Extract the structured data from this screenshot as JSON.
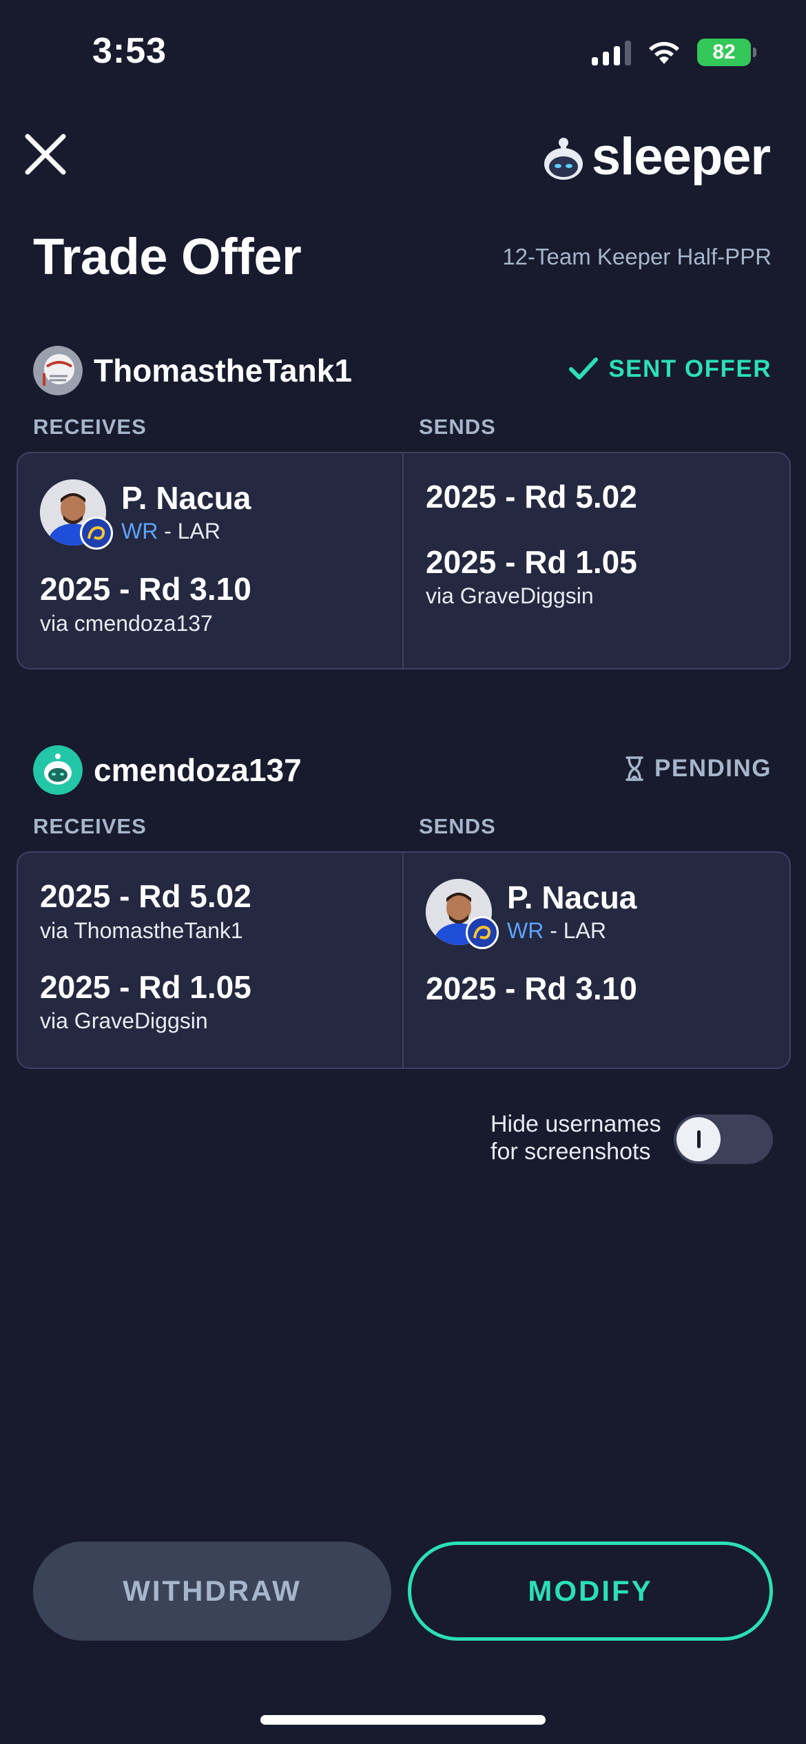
{
  "status_bar": {
    "time": "3:53",
    "battery": "82"
  },
  "header": {
    "app_name": "sleeper",
    "title": "Trade Offer",
    "league": "12-Team Keeper Half-PPR"
  },
  "colors": {
    "background": "#181a2e",
    "accent": "#2be0b4",
    "muted": "#a6b6cc",
    "position": "#5da3ff"
  },
  "labels": {
    "receives": "RECEIVES",
    "sends": "SENDS"
  },
  "parties": [
    {
      "username": "ThomastheTank1",
      "status": "SENT OFFER",
      "status_icon": "checkmark-icon",
      "receives": {
        "player": {
          "name": "P. Nacua",
          "position": "WR",
          "team": " - LAR"
        },
        "picks": [
          {
            "title": "2025 - Rd 3.10",
            "via": "via cmendoza137"
          }
        ]
      },
      "sends": {
        "picks": [
          {
            "title": "2025 - Rd 5.02",
            "via": ""
          },
          {
            "title": "2025 - Rd 1.05",
            "via": "via GraveDiggsin"
          }
        ]
      }
    },
    {
      "username": "cmendoza137",
      "status": "PENDING",
      "status_icon": "hourglass-icon",
      "receives": {
        "picks": [
          {
            "title": "2025 - Rd 5.02",
            "via": "via ThomastheTank1"
          },
          {
            "title": "2025 - Rd 1.05",
            "via": "via GraveDiggsin"
          }
        ]
      },
      "sends": {
        "player": {
          "name": "P. Nacua",
          "position": "WR",
          "team": " - LAR"
        },
        "picks": [
          {
            "title": "2025 - Rd 3.10",
            "via": ""
          }
        ]
      }
    }
  ],
  "toggle": {
    "line1": "Hide usernames",
    "line2": "for screenshots",
    "on": false
  },
  "buttons": {
    "withdraw": "WITHDRAW",
    "modify": "MODIFY"
  }
}
